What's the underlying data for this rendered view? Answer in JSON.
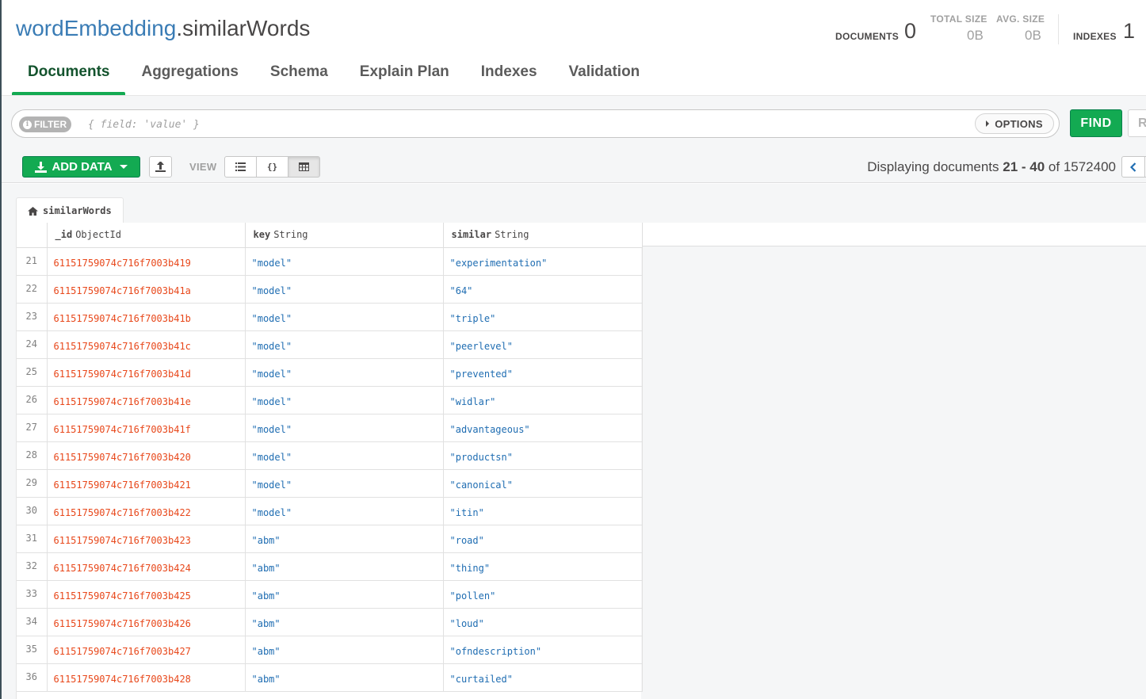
{
  "namespace": {
    "database": "wordEmbedding",
    "collection": ".similarWords"
  },
  "stats": {
    "documents_label": "DOCUMENTS",
    "documents_value": "0",
    "total_size_label": "TOTAL SIZE",
    "total_size_value": "0B",
    "avg_size_label": "AVG. SIZE",
    "avg_size_value": "0B",
    "indexes_label": "INDEXES",
    "indexes_value": "1"
  },
  "tabs": [
    "Documents",
    "Aggregations",
    "Schema",
    "Explain Plan",
    "Indexes",
    "Validation"
  ],
  "active_tab": "Documents",
  "query": {
    "filter_label": "FILTER",
    "filter_placeholder": "{ field: 'value' }",
    "options_label": "OPTIONS",
    "find_label": "FIND",
    "reset_label": "R"
  },
  "toolbar": {
    "add_data_label": "ADD DATA",
    "view_label": "VIEW",
    "view_modes": [
      "list",
      "json",
      "table"
    ],
    "active_view": "table",
    "display_prefix": "Displaying documents ",
    "display_range": "21 - 40",
    "display_of": " of ",
    "display_total": "1572400"
  },
  "grid": {
    "tab_label": "similarWords",
    "columns": [
      {
        "name": "_id",
        "type": "ObjectId"
      },
      {
        "name": "key",
        "type": "String"
      },
      {
        "name": "similar",
        "type": "String"
      }
    ],
    "rows": [
      {
        "n": "21",
        "id": "61151759074c716f7003b419",
        "key": "\"model\"",
        "similar": "\"experimentation\""
      },
      {
        "n": "22",
        "id": "61151759074c716f7003b41a",
        "key": "\"model\"",
        "similar": "\"64\""
      },
      {
        "n": "23",
        "id": "61151759074c716f7003b41b",
        "key": "\"model\"",
        "similar": "\"triple\""
      },
      {
        "n": "24",
        "id": "61151759074c716f7003b41c",
        "key": "\"model\"",
        "similar": "\"peerlevel\""
      },
      {
        "n": "25",
        "id": "61151759074c716f7003b41d",
        "key": "\"model\"",
        "similar": "\"prevented\""
      },
      {
        "n": "26",
        "id": "61151759074c716f7003b41e",
        "key": "\"model\"",
        "similar": "\"widlar\""
      },
      {
        "n": "27",
        "id": "61151759074c716f7003b41f",
        "key": "\"model\"",
        "similar": "\"advantageous\""
      },
      {
        "n": "28",
        "id": "61151759074c716f7003b420",
        "key": "\"model\"",
        "similar": "\"productsn\""
      },
      {
        "n": "29",
        "id": "61151759074c716f7003b421",
        "key": "\"model\"",
        "similar": "\"canonical\""
      },
      {
        "n": "30",
        "id": "61151759074c716f7003b422",
        "key": "\"model\"",
        "similar": "\"itin\""
      },
      {
        "n": "31",
        "id": "61151759074c716f7003b423",
        "key": "\"abm\"",
        "similar": "\"road\""
      },
      {
        "n": "32",
        "id": "61151759074c716f7003b424",
        "key": "\"abm\"",
        "similar": "\"thing\""
      },
      {
        "n": "33",
        "id": "61151759074c716f7003b425",
        "key": "\"abm\"",
        "similar": "\"pollen\""
      },
      {
        "n": "34",
        "id": "61151759074c716f7003b426",
        "key": "\"abm\"",
        "similar": "\"loud\""
      },
      {
        "n": "35",
        "id": "61151759074c716f7003b427",
        "key": "\"abm\"",
        "similar": "\"ofndescription\""
      },
      {
        "n": "36",
        "id": "61151759074c716f7003b428",
        "key": "\"abm\"",
        "similar": "\"curtailed\""
      }
    ]
  },
  "colors": {
    "accent_green": "#13aa52",
    "link_blue": "#3a7cb5",
    "objectid": "#e8481b",
    "string": "#1f6db2"
  },
  "icons": [
    "info-icon",
    "options-caret-icon",
    "download-icon",
    "dropdown-caret-icon",
    "export-icon",
    "list-view-icon",
    "json-view-icon",
    "table-view-icon",
    "chevron-left-icon",
    "home-icon"
  ]
}
